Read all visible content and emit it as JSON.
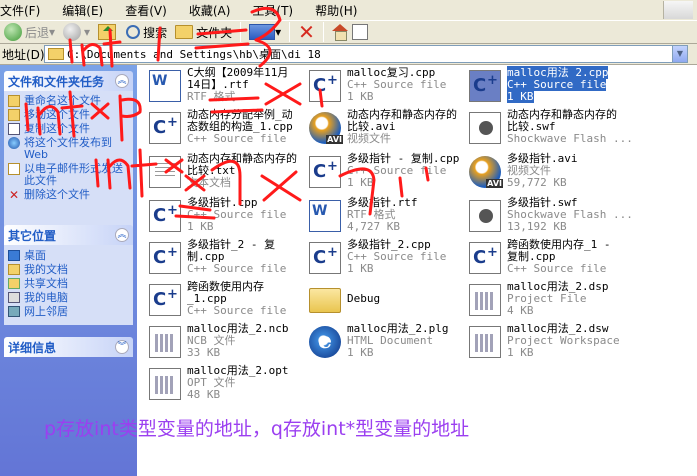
{
  "menu": [
    "文件(F)",
    "编辑(E)",
    "查看(V)",
    "收藏(A)",
    "工具(T)",
    "帮助(H)"
  ],
  "toolbar": {
    "back": "后退",
    "search": "搜索",
    "folders": "文件夹"
  },
  "address": {
    "label": "地址(D)",
    "path": "C:\\Documents and Settings\\hb\\桌面\\di 18"
  },
  "tasks": {
    "title": "文件和文件夹任务",
    "items": [
      "重命名这个文件",
      "移动这个文件",
      "复制这个文件",
      "将这个文件发布到 Web",
      "以电子邮件形式发送此文件",
      "删除这个文件"
    ]
  },
  "places": {
    "title": "其它位置",
    "items": [
      "桌面",
      "我的文档",
      "共享文档",
      "我的电脑",
      "网上邻居"
    ]
  },
  "details": {
    "title": "详细信息"
  },
  "files": [
    {
      "name": "C大纲【2009年11月14日】.rtf",
      "type": "RTF 格式",
      "size": "",
      "icon": "rtf-icon"
    },
    {
      "name": "malloc复习.cpp",
      "type": "C++ Source file",
      "size": "1 KB",
      "icon": "cpp-icon"
    },
    {
      "name": "malloc用法_2.cpp",
      "type": "C++ Source file",
      "size": "1 KB",
      "icon": "cpp-icon"
    },
    {
      "name": "动态内存分配举例_动态数组的构造_1.cpp",
      "type": "C++ Source file",
      "size": "",
      "icon": "cpp-icon"
    },
    {
      "name": "动态内存和静态内存的比较.avi",
      "type": "视频文件",
      "size": "",
      "icon": "avi-icon"
    },
    {
      "name": "动态内存和静态内存的比较.swf",
      "type": "Shockwave Flash ...",
      "size": "",
      "icon": "swf-icon"
    },
    {
      "name": "动态内存和静态内存的比较.txt",
      "type": "文本文档",
      "size": "",
      "icon": "txt-icon"
    },
    {
      "name": "多级指针 - 复制.cpp",
      "type": "C++ Source file",
      "size": "1 KB",
      "icon": "cpp-icon"
    },
    {
      "name": "多级指针.avi",
      "type": "视频文件",
      "size": "59,772 KB",
      "icon": "avi-icon"
    },
    {
      "name": "多级指针.cpp",
      "type": "C++ Source file",
      "size": "1 KB",
      "icon": "cpp-icon"
    },
    {
      "name": "多级指针.rtf",
      "type": "RTF 格式",
      "size": "4,727 KB",
      "icon": "rtf-icon"
    },
    {
      "name": "多级指针.swf",
      "type": "Shockwave Flash ...",
      "size": "13,192 KB",
      "icon": "swf-icon"
    },
    {
      "name": "多级指针_2 - 复制.cpp",
      "type": "C++ Source file",
      "size": "",
      "icon": "cpp-icon"
    },
    {
      "name": "多级指针_2.cpp",
      "type": "C++ Source file",
      "size": "1 KB",
      "icon": "cpp-icon"
    },
    {
      "name": "跨函数使用内存_1 - 复制.cpp",
      "type": "C++ Source file",
      "size": "",
      "icon": "cpp-icon"
    },
    {
      "name": "跨函数使用内存_1.cpp",
      "type": "C++ Source file",
      "size": "",
      "icon": "cpp-icon"
    },
    {
      "name": "Debug",
      "type": "",
      "size": "",
      "icon": "folder-icon"
    },
    {
      "name": "malloc用法_2.dsp",
      "type": "Project File",
      "size": "4 KB",
      "icon": "dsp-icon"
    },
    {
      "name": "malloc用法_2.ncb",
      "type": "NCB 文件",
      "size": "33 KB",
      "icon": "ncb-icon"
    },
    {
      "name": "malloc用法_2.plg",
      "type": "HTML Document",
      "size": "1 KB",
      "icon": "html-icon"
    },
    {
      "name": "malloc用法_2.dsw",
      "type": "Project Workspace",
      "size": "1 KB",
      "icon": "dsw-icon"
    },
    {
      "name": "malloc用法_2.opt",
      "type": "OPT 文件",
      "size": "48 KB",
      "icon": "opt-icon"
    }
  ],
  "annotation": {
    "caption": "p存放int类型变量的地址，q存放int*型变量的地址",
    "handwriting": [
      "int i = 3",
      "int * p = &i",
      "int ** q = &p"
    ],
    "colors": {
      "ink": "#ff1a1a",
      "caption": "#9b3ff0"
    }
  },
  "colors": {
    "selection": "#316ac5",
    "taskpane": "#6c8ae0",
    "link": "#215dc6"
  }
}
